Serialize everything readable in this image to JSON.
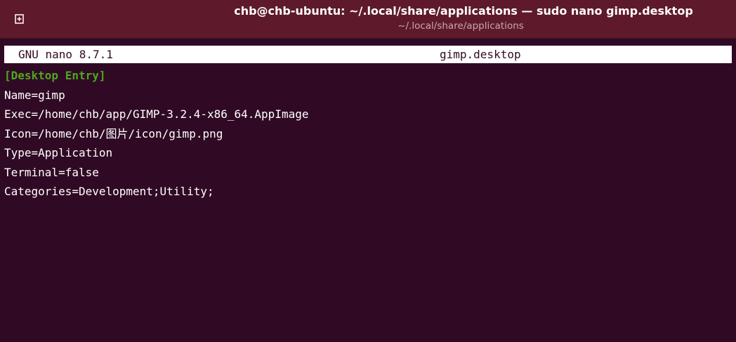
{
  "window": {
    "title": "chb@chb-ubuntu: ~/.local/share/applications — sudo nano gimp.desktop",
    "subtitle": "~/.local/share/applications",
    "new_tab_icon": "new-tab-icon"
  },
  "nano": {
    "version": "GNU nano 8.7.1",
    "filename": "gimp.desktop"
  },
  "editor": {
    "lines": [
      "[Desktop Entry]",
      "Name=gimp",
      "Exec=/home/chb/app/GIMP-3.2.4-x86_64.AppImage",
      "Icon=/home/chb/图片/icon/gimp.png",
      "Type=Application",
      "Terminal=false",
      "Categories=Development;Utility;"
    ]
  },
  "colors": {
    "titlebar": "#5e1a2a",
    "terminal_bg": "#300a24",
    "section_header": "#4ea61f",
    "text": "#ffffff"
  }
}
